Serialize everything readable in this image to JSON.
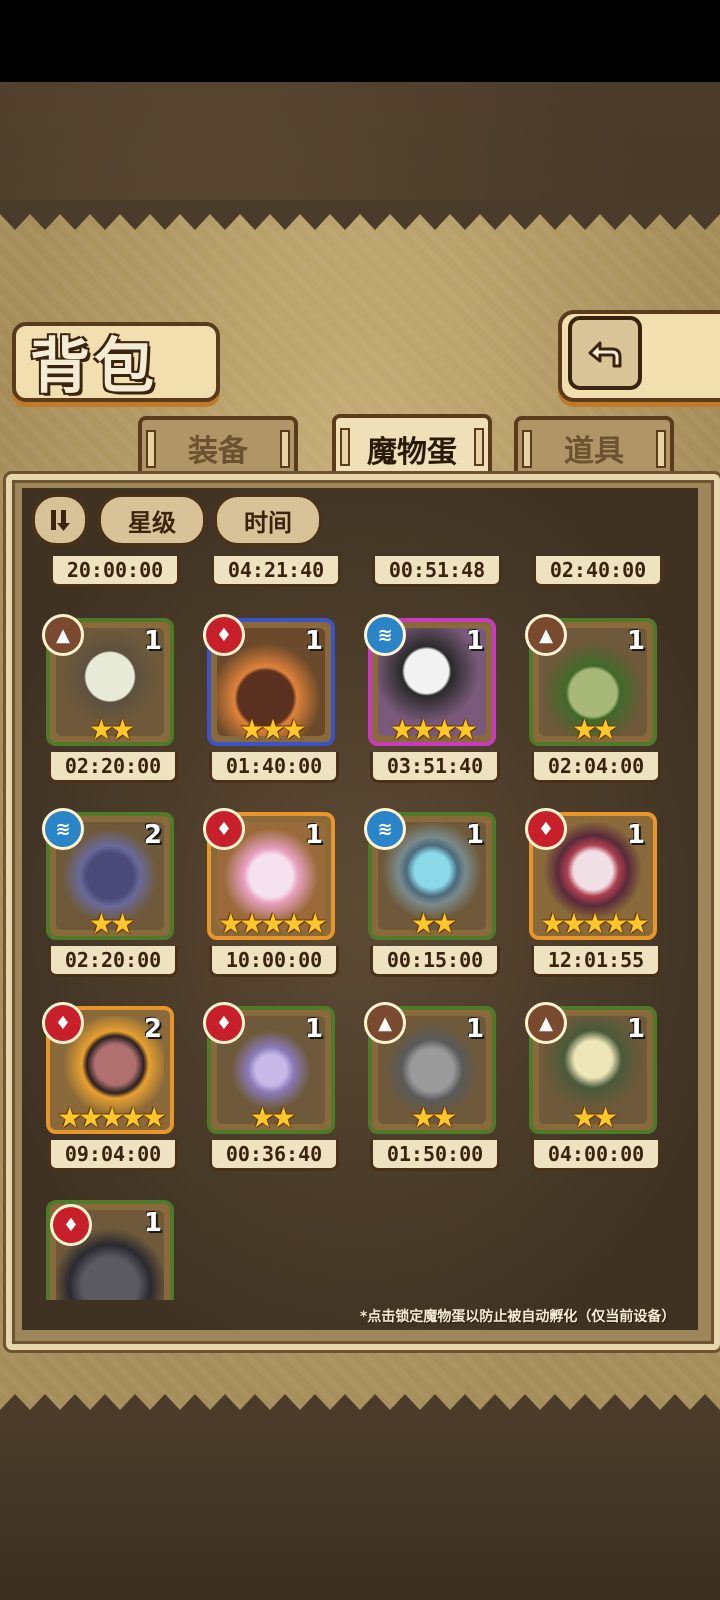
{
  "title": "背包",
  "tabs": [
    {
      "label": "装备",
      "active": false
    },
    {
      "label": "魔物蛋",
      "active": true
    },
    {
      "label": "道具",
      "active": false
    }
  ],
  "controls": {
    "sort_icon": "sort-toggle-icon",
    "star_label": "星级",
    "time_label": "时间"
  },
  "top_timers": [
    "20:00:00",
    "04:21:40",
    "00:51:48",
    "02:40:00"
  ],
  "eggs": [
    {
      "element": "earth",
      "count": "1",
      "stars": "★★",
      "timer": "02:20:00",
      "rarity": "green"
    },
    {
      "element": "fire",
      "count": "1",
      "stars": "★★★",
      "timer": "01:40:00",
      "rarity": "blue"
    },
    {
      "element": "water",
      "count": "1",
      "stars": "★★★★",
      "timer": "03:51:40",
      "rarity": "purple"
    },
    {
      "element": "earth",
      "count": "1",
      "stars": "★★",
      "timer": "02:04:00",
      "rarity": "green"
    },
    {
      "element": "water",
      "count": "2",
      "stars": "★★",
      "timer": "02:20:00",
      "rarity": "green"
    },
    {
      "element": "fire",
      "count": "1",
      "stars": "★★★★★",
      "timer": "10:00:00",
      "rarity": "orange"
    },
    {
      "element": "water",
      "count": "1",
      "stars": "★★",
      "timer": "00:15:00",
      "rarity": "green"
    },
    {
      "element": "fire",
      "count": "1",
      "stars": "★★★★★",
      "timer": "12:01:55",
      "rarity": "orange"
    },
    {
      "element": "fire",
      "count": "2",
      "stars": "★★★★★",
      "timer": "09:04:00",
      "rarity": "orange"
    },
    {
      "element": "fire",
      "count": "1",
      "stars": "★★",
      "timer": "00:36:40",
      "rarity": "green"
    },
    {
      "element": "earth",
      "count": "1",
      "stars": "★★",
      "timer": "01:50:00",
      "rarity": "green"
    },
    {
      "element": "earth",
      "count": "1",
      "stars": "★★",
      "timer": "04:00:00",
      "rarity": "green"
    },
    {
      "element": "fire",
      "count": "1",
      "stars": "",
      "timer": "",
      "rarity": "green"
    }
  ],
  "hint": "*点击锁定魔物蛋以防止被自动孵化（仅当前设备）",
  "colors": {
    "rarity_green": "#4f7a2a",
    "rarity_blue": "#3b53c8",
    "rarity_purple": "#c83bc0",
    "rarity_orange": "#e8962a",
    "fire": "#c8202a",
    "water": "#2a84c8",
    "earth": "#7a4a30"
  }
}
